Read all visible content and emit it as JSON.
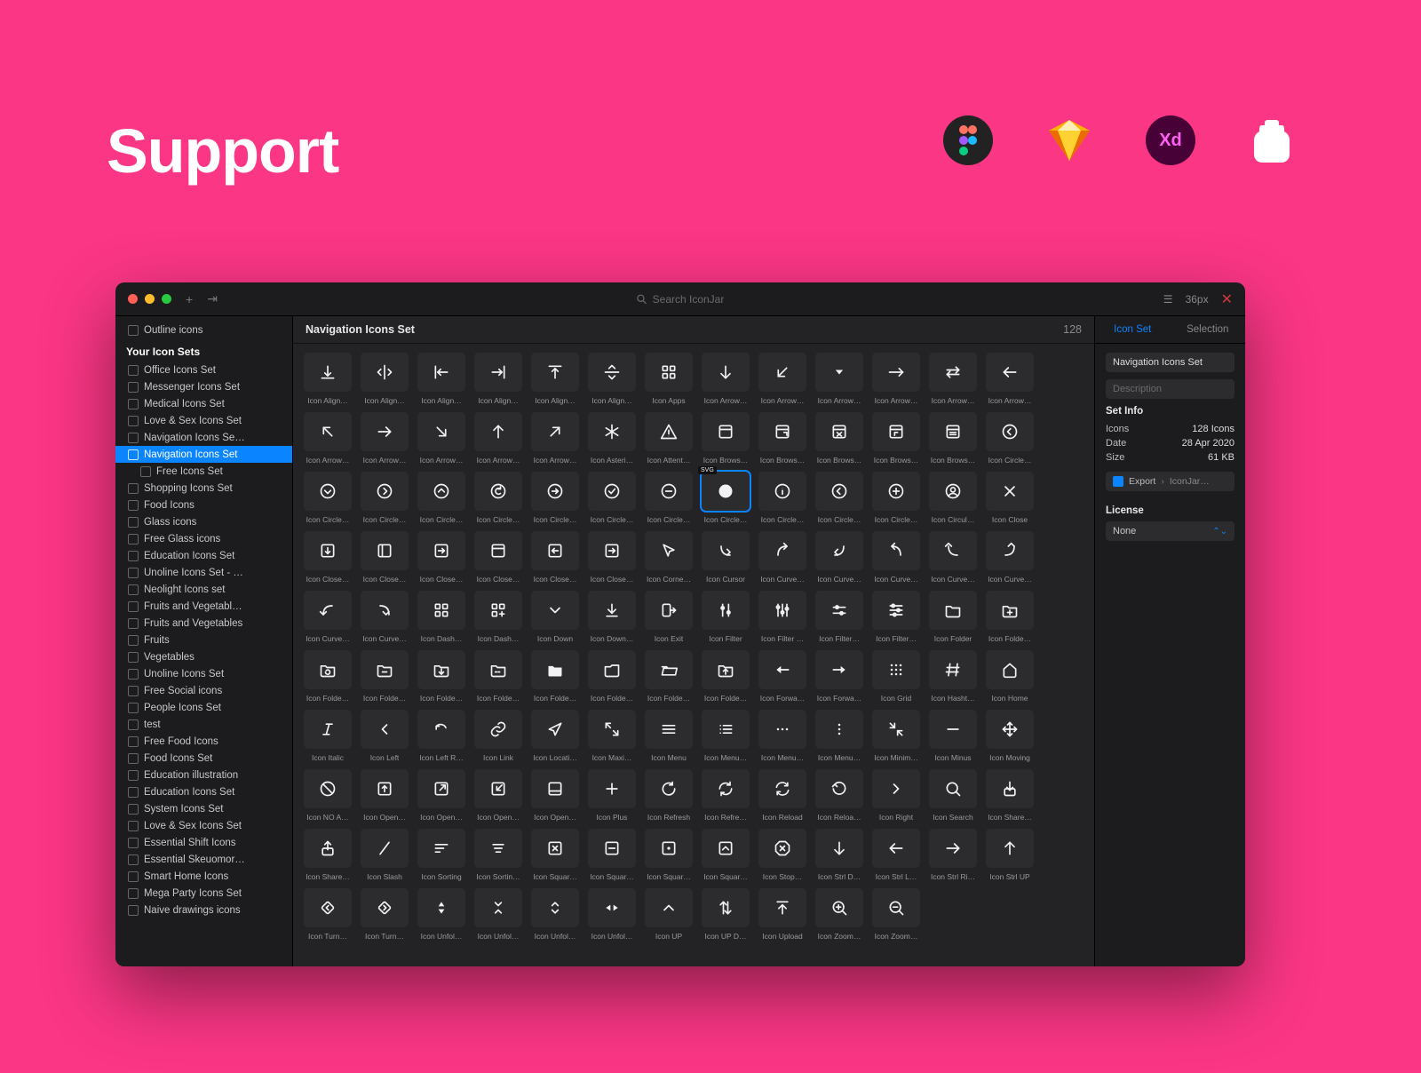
{
  "hero": {
    "title": "Support"
  },
  "apps": [
    "Figma",
    "Sketch",
    "Adobe XD",
    "IconJar"
  ],
  "titlebar": {
    "search_placeholder": "Search IconJar",
    "size_label": "36px"
  },
  "sidebar": {
    "top_item": "Outline icons",
    "section": "Your Icon Sets",
    "items": [
      {
        "label": "Office Icons Set"
      },
      {
        "label": "Messenger Icons Set"
      },
      {
        "label": "Medical Icons Set"
      },
      {
        "label": "Love & Sex Icons Set"
      },
      {
        "label": "Navigation Icons Se…"
      },
      {
        "label": "Navigation Icons Set",
        "selected": true
      },
      {
        "label": "Free Icons Set",
        "indent": true
      },
      {
        "label": "Shopping Icons Set"
      },
      {
        "label": "Food Icons"
      },
      {
        "label": "Glass icons"
      },
      {
        "label": "Free Glass icons"
      },
      {
        "label": "Education Icons Set"
      },
      {
        "label": "Unoline Icons Set - …"
      },
      {
        "label": "Neolight Icons set"
      },
      {
        "label": "Fruits and Vegetabl…"
      },
      {
        "label": "Fruits and Vegetables"
      },
      {
        "label": "Fruits"
      },
      {
        "label": "Vegetables"
      },
      {
        "label": "Unoline Icons Set"
      },
      {
        "label": "Free Social icons"
      },
      {
        "label": "People Icons Set"
      },
      {
        "label": "test"
      },
      {
        "label": "Free Food Icons"
      },
      {
        "label": "Food Icons Set"
      },
      {
        "label": "Education illustration"
      },
      {
        "label": "Education Icons Set"
      },
      {
        "label": "System Icons Set"
      },
      {
        "label": "Love & Sex Icons Set"
      },
      {
        "label": "Essential Shift Icons"
      },
      {
        "label": "Essential Skeuomor…"
      },
      {
        "label": "Smart Home Icons"
      },
      {
        "label": "Mega Party Icons Set"
      },
      {
        "label": "Naive drawings icons"
      }
    ]
  },
  "set": {
    "title": "Navigation Icons Set",
    "count": "128"
  },
  "inspector": {
    "tab_icon_set": "Icon Set",
    "tab_selection": "Selection",
    "name": "Navigation Icons Set",
    "desc_placeholder": "Description",
    "setinfo_title": "Set Info",
    "icons_label": "Icons",
    "icons_value": "128 Icons",
    "date_label": "Date",
    "date_value": "28 Apr 2020",
    "size_label": "Size",
    "size_value": "61 KB",
    "export_label": "Export",
    "export_value": "IconJar…",
    "license_title": "License",
    "license_value": "None"
  },
  "grid": [
    [
      {
        "l": "Icon Align…",
        "g": "align-bottom"
      },
      {
        "l": "Icon Align…",
        "g": "align-center-h"
      },
      {
        "l": "Icon Align…",
        "g": "align-left"
      },
      {
        "l": "Icon Align…",
        "g": "align-right"
      },
      {
        "l": "Icon Align…",
        "g": "align-top"
      },
      {
        "l": "Icon Align…",
        "g": "align-center-v"
      },
      {
        "l": "Icon Apps",
        "g": "grid4"
      },
      {
        "l": "Icon Arrow…",
        "g": "arrow-down"
      },
      {
        "l": "Icon Arrow…",
        "g": "arrow-down-left"
      },
      {
        "l": "Icon Arrow…",
        "g": "caret-down"
      },
      {
        "l": "Icon Arrow…",
        "g": "arrow-right-long"
      },
      {
        "l": "Icon Arrow…",
        "g": "swap-h"
      },
      {
        "l": "Icon Arrow…",
        "g": "arrow-left"
      }
    ],
    [
      {
        "l": "Icon Arrow…",
        "g": "arrow-up-left"
      },
      {
        "l": "Icon Arrow…",
        "g": "arrow-right"
      },
      {
        "l": "Icon Arrow…",
        "g": "arrow-down-right"
      },
      {
        "l": "Icon Arrow…",
        "g": "arrow-up"
      },
      {
        "l": "Icon Arrow…",
        "g": "arrow-up-right"
      },
      {
        "l": "Icon Asteri…",
        "g": "asterisk"
      },
      {
        "l": "Icon Attent…",
        "g": "warning"
      },
      {
        "l": "Icon Brows…",
        "g": "browser"
      },
      {
        "l": "Icon Brows…",
        "g": "browser-out"
      },
      {
        "l": "Icon Brows…",
        "g": "browser-x"
      },
      {
        "l": "Icon Brows…",
        "g": "browser-in"
      },
      {
        "l": "Icon Brows…",
        "g": "browser-eq"
      },
      {
        "l": "Icon Circle…",
        "g": "circle-left"
      }
    ],
    [
      {
        "l": "Icon Circle…",
        "g": "circle-down"
      },
      {
        "l": "Icon Circle…",
        "g": "circle-right"
      },
      {
        "l": "Icon Circle…",
        "g": "circle-up"
      },
      {
        "l": "Icon Circle…",
        "g": "circle-back"
      },
      {
        "l": "Icon Circle…",
        "g": "circle-enter"
      },
      {
        "l": "Icon Circle…",
        "g": "circle-check"
      },
      {
        "l": "Icon Circle…",
        "g": "circle-minus"
      },
      {
        "l": "Icon Circle…",
        "g": "circle-x",
        "sel": true,
        "tag": "SVG"
      },
      {
        "l": "Icon Circle…",
        "g": "circle-info"
      },
      {
        "l": "Icon Circle…",
        "g": "circle-chev-left"
      },
      {
        "l": "Icon Circle…",
        "g": "circle-plus"
      },
      {
        "l": "Icon Circul…",
        "g": "circle-user"
      },
      {
        "l": "Icon Close",
        "g": "x"
      }
    ],
    [
      {
        "l": "Icon Close…",
        "g": "box-down"
      },
      {
        "l": "Icon Close…",
        "g": "box-left-bar"
      },
      {
        "l": "Icon Close…",
        "g": "box-in-right"
      },
      {
        "l": "Icon Close…",
        "g": "box-top-bar"
      },
      {
        "l": "Icon Close…",
        "g": "box-arrow-l"
      },
      {
        "l": "Icon Close…",
        "g": "box-arrow-r"
      },
      {
        "l": "Icon Corne…",
        "g": "cursor"
      },
      {
        "l": "Icon Cursor",
        "g": "curve-dr"
      },
      {
        "l": "Icon Curve…",
        "g": "curve-tr"
      },
      {
        "l": "Icon Curve…",
        "g": "curve-dl"
      },
      {
        "l": "Icon Curve…",
        "g": "curve-tl"
      },
      {
        "l": "Icon Curve…",
        "g": "curve-ul"
      },
      {
        "l": "Icon Curve…",
        "g": "curve-ru"
      }
    ],
    [
      {
        "l": "Icon Curve…",
        "g": "curve-lu"
      },
      {
        "l": "Icon Curve…",
        "g": "curve-rd"
      },
      {
        "l": "Icon Dash…",
        "g": "grid4"
      },
      {
        "l": "Icon Dash…",
        "g": "grid4-plus"
      },
      {
        "l": "Icon Down",
        "g": "chev-down"
      },
      {
        "l": "Icon Down…",
        "g": "download"
      },
      {
        "l": "Icon Exit",
        "g": "exit"
      },
      {
        "l": "Icon Filter",
        "g": "sliders"
      },
      {
        "l": "Icon Filter …",
        "g": "sliders2"
      },
      {
        "l": "Icon Filter…",
        "g": "sliders-h"
      },
      {
        "l": "Icon Filter…",
        "g": "sliders-h2"
      },
      {
        "l": "Icon Folder",
        "g": "folder"
      },
      {
        "l": "Icon Folde…",
        "g": "folder-plus"
      }
    ],
    [
      {
        "l": "Icon Folde…",
        "g": "folder-refresh"
      },
      {
        "l": "Icon Folde…",
        "g": "folder-minus"
      },
      {
        "l": "Icon Folde…",
        "g": "folder-down"
      },
      {
        "l": "Icon Folde…",
        "g": "folder-dash"
      },
      {
        "l": "Icon Folde…",
        "g": "folder-solid"
      },
      {
        "l": "Icon Folde…",
        "g": "folder-alt"
      },
      {
        "l": "Icon Folde…",
        "g": "folder-open"
      },
      {
        "l": "Icon Folde…",
        "g": "folder-up"
      },
      {
        "l": "Icon Forwa…",
        "g": "back"
      },
      {
        "l": "Icon Forwa…",
        "g": "forward"
      },
      {
        "l": "Icon Grid",
        "g": "grid9"
      },
      {
        "l": "Icon Hasht…",
        "g": "hash"
      },
      {
        "l": "Icon Home",
        "g": "home"
      }
    ],
    [
      {
        "l": "Icon Italic",
        "g": "italic"
      },
      {
        "l": "Icon Left",
        "g": "chev-left"
      },
      {
        "l": "Icon Left R…",
        "g": "undo"
      },
      {
        "l": "Icon Link",
        "g": "link"
      },
      {
        "l": "Icon Locati…",
        "g": "nav"
      },
      {
        "l": "Icon Maxi…",
        "g": "maximize"
      },
      {
        "l": "Icon Menu",
        "g": "menu"
      },
      {
        "l": "Icon Menu…",
        "g": "list"
      },
      {
        "l": "Icon Menu…",
        "g": "dots-h"
      },
      {
        "l": "Icon Menu…",
        "g": "dots-v"
      },
      {
        "l": "Icon Minim…",
        "g": "minimize"
      },
      {
        "l": "Icon Minus",
        "g": "minus"
      },
      {
        "l": "Icon Moving",
        "g": "move"
      }
    ],
    [
      {
        "l": "Icon NO A…",
        "g": "ban"
      },
      {
        "l": "Icon Open…",
        "g": "box-up"
      },
      {
        "l": "Icon Open…",
        "g": "box-arrow-out"
      },
      {
        "l": "Icon Open…",
        "g": "box-arrow-in"
      },
      {
        "l": "Icon Open…",
        "g": "box-bottom-bar"
      },
      {
        "l": "Icon Plus",
        "g": "plus"
      },
      {
        "l": "Icon Refresh",
        "g": "refresh-one"
      },
      {
        "l": "Icon Refre…",
        "g": "refresh"
      },
      {
        "l": "Icon Reload",
        "g": "reload"
      },
      {
        "l": "Icon Reloa…",
        "g": "reload-alt"
      },
      {
        "l": "Icon Right",
        "g": "chev-right"
      },
      {
        "l": "Icon Search",
        "g": "search"
      },
      {
        "l": "Icon Share…",
        "g": "share-down"
      }
    ],
    [
      {
        "l": "Icon Share…",
        "g": "share-up"
      },
      {
        "l": "Icon Slash",
        "g": "slash"
      },
      {
        "l": "Icon Sorting",
        "g": "sort-l"
      },
      {
        "l": "Icon Sortin…",
        "g": "sort-c"
      },
      {
        "l": "Icon Squar…",
        "g": "square-x"
      },
      {
        "l": "Icon Squar…",
        "g": "square-minus"
      },
      {
        "l": "Icon Squar…",
        "g": "square-dot"
      },
      {
        "l": "Icon Squar…",
        "g": "square-up"
      },
      {
        "l": "Icon Stop…",
        "g": "octagon-x"
      },
      {
        "l": "Icon Strl D…",
        "g": "arrow-down"
      },
      {
        "l": "Icon Strl L…",
        "g": "arrow-left"
      },
      {
        "l": "Icon Strl Ri…",
        "g": "arrow-right"
      },
      {
        "l": "Icon Strl UP",
        "g": "arrow-up"
      }
    ],
    [
      {
        "l": "Icon Turn…",
        "g": "diamond-l"
      },
      {
        "l": "Icon Turn…",
        "g": "diamond-r"
      },
      {
        "l": "Icon Unfol…",
        "g": "unfold-v"
      },
      {
        "l": "Icon Unfol…",
        "g": "unfold-in"
      },
      {
        "l": "Icon Unfol…",
        "g": "unfold-out"
      },
      {
        "l": "Icon Unfol…",
        "g": "unfold-h"
      },
      {
        "l": "Icon UP",
        "g": "chev-up"
      },
      {
        "l": "Icon UP D…",
        "g": "swap-v"
      },
      {
        "l": "Icon Upload",
        "g": "upload"
      },
      {
        "l": "Icon Zoom…",
        "g": "zoom-in"
      },
      {
        "l": "Icon Zoom…",
        "g": "zoom-out"
      }
    ]
  ]
}
